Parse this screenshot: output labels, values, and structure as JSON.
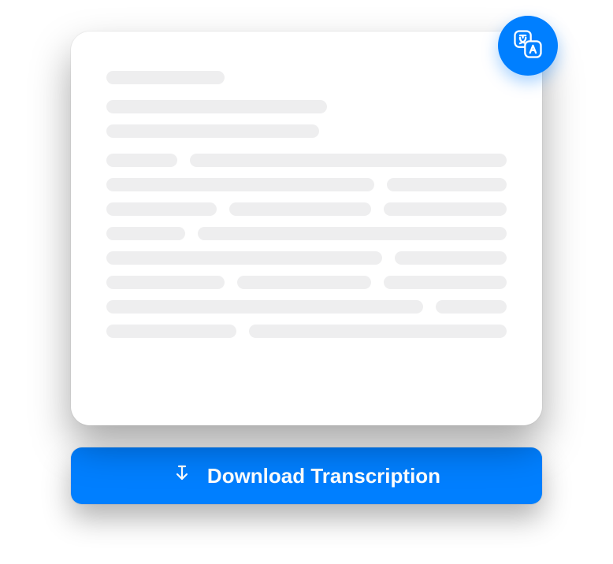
{
  "translate_badge": {
    "icon_name": "translate-icon"
  },
  "download_button": {
    "label": "Download Transcription",
    "icon_name": "download-icon"
  },
  "colors": {
    "accent": "#007FFF",
    "skeleton": "#EEEEEF"
  }
}
